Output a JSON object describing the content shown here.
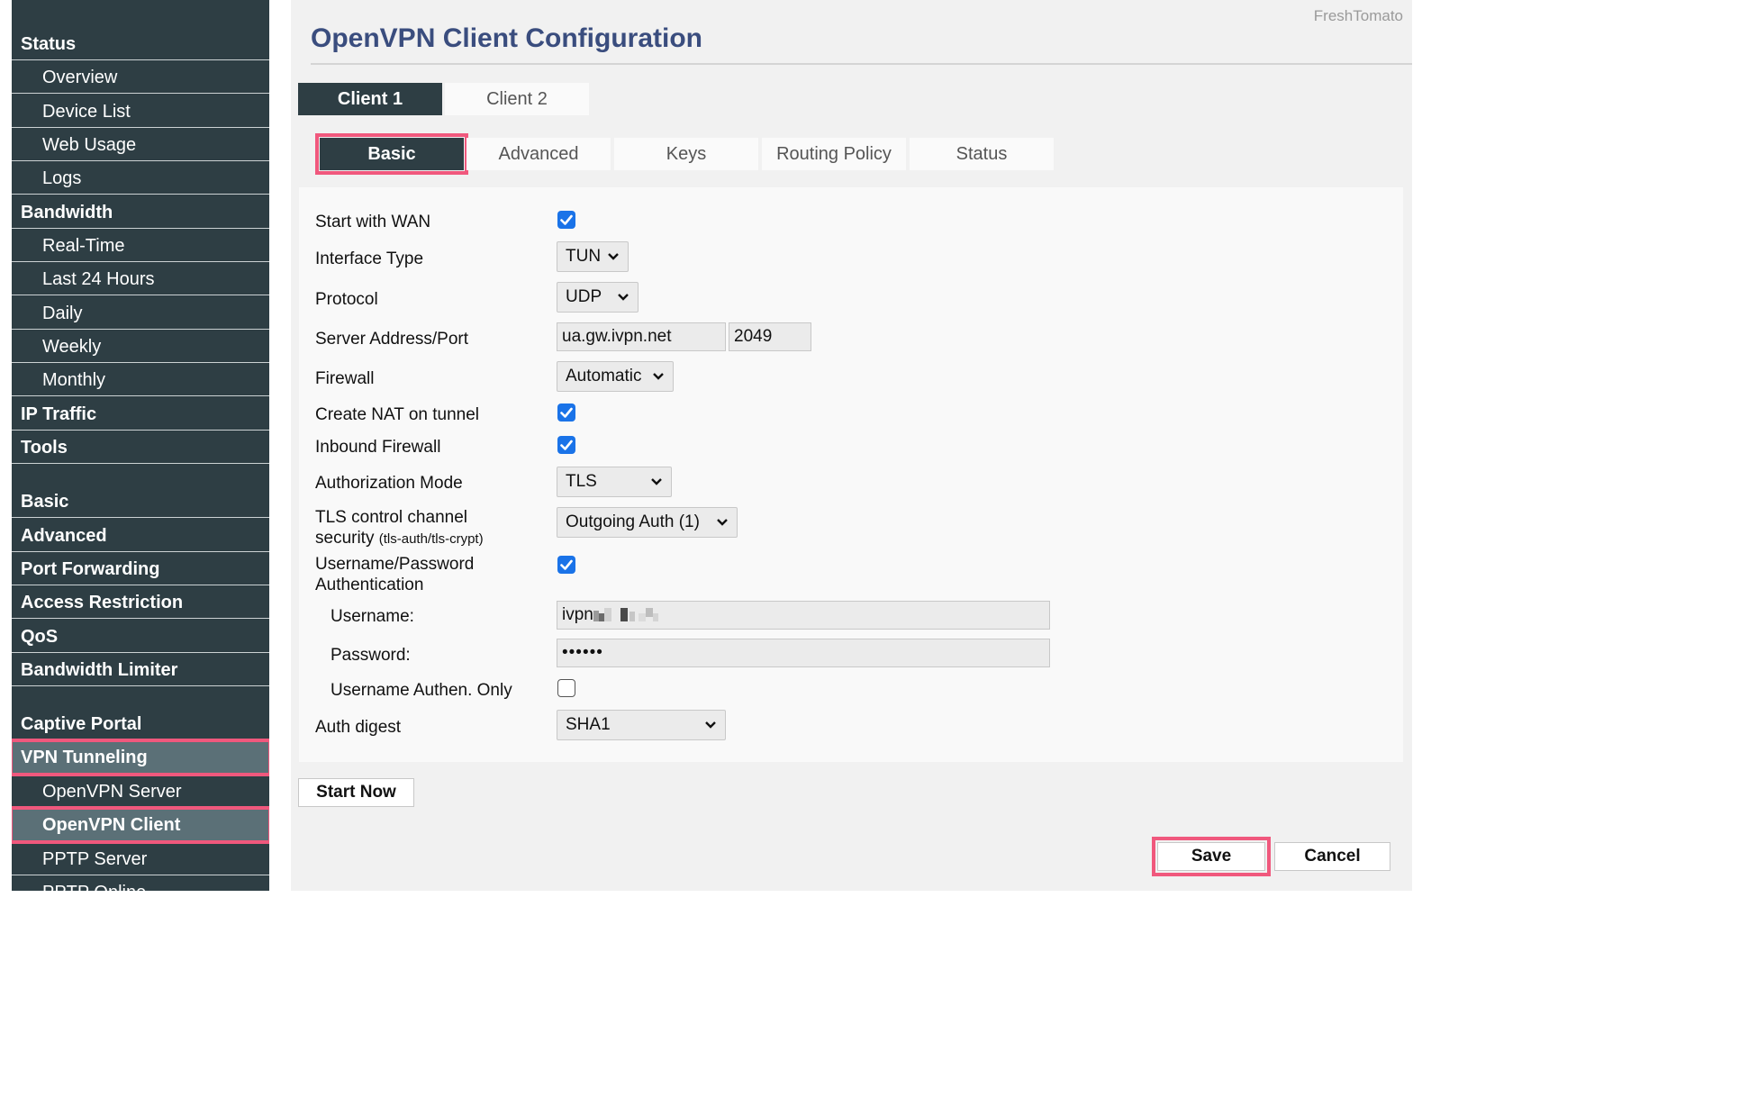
{
  "sidebar": {
    "items": [
      {
        "label": "Status",
        "kind": "section"
      },
      {
        "label": "Overview",
        "kind": "sub"
      },
      {
        "label": "Device List",
        "kind": "sub"
      },
      {
        "label": "Web Usage",
        "kind": "sub"
      },
      {
        "label": "Logs",
        "kind": "sub"
      },
      {
        "label": "Bandwidth",
        "kind": "section"
      },
      {
        "label": "Real-Time",
        "kind": "sub"
      },
      {
        "label": "Last 24 Hours",
        "kind": "sub"
      },
      {
        "label": "Daily",
        "kind": "sub"
      },
      {
        "label": "Weekly",
        "kind": "sub"
      },
      {
        "label": "Monthly",
        "kind": "sub"
      },
      {
        "label": "IP Traffic",
        "kind": "section"
      },
      {
        "label": "Tools",
        "kind": "section"
      },
      {
        "label": "Basic",
        "kind": "section"
      },
      {
        "label": "Advanced",
        "kind": "section"
      },
      {
        "label": "Port Forwarding",
        "kind": "section"
      },
      {
        "label": "Access Restriction",
        "kind": "section"
      },
      {
        "label": "QoS",
        "kind": "section"
      },
      {
        "label": "Bandwidth Limiter",
        "kind": "section"
      },
      {
        "label": "Captive Portal",
        "kind": "section"
      },
      {
        "label": "VPN Tunneling",
        "kind": "section"
      },
      {
        "label": "OpenVPN Server",
        "kind": "sub"
      },
      {
        "label": "OpenVPN Client",
        "kind": "sub"
      },
      {
        "label": "PPTP Server",
        "kind": "sub"
      },
      {
        "label": "PPTP Online",
        "kind": "sub"
      }
    ]
  },
  "header": {
    "brand": "FreshTomato",
    "title": "OpenVPN Client Configuration"
  },
  "client_tabs": [
    {
      "label": "Client 1",
      "active": true
    },
    {
      "label": "Client 2",
      "active": false
    }
  ],
  "section_tabs": [
    {
      "label": "Basic",
      "active": true
    },
    {
      "label": "Advanced",
      "active": false
    },
    {
      "label": "Keys",
      "active": false
    },
    {
      "label": "Routing Policy",
      "active": false
    },
    {
      "label": "Status",
      "active": false
    }
  ],
  "form": {
    "start_with_wan": {
      "label": "Start with WAN",
      "checked": true
    },
    "interface_type": {
      "label": "Interface Type",
      "value": "TUN"
    },
    "protocol": {
      "label": "Protocol",
      "value": "UDP"
    },
    "server": {
      "label": "Server Address/Port",
      "address": "ua.gw.ivpn.net",
      "port": "2049"
    },
    "firewall": {
      "label": "Firewall",
      "value": "Automatic"
    },
    "create_nat": {
      "label": "Create NAT on tunnel",
      "checked": true
    },
    "inbound_firewall": {
      "label": "Inbound Firewall",
      "checked": true
    },
    "auth_mode": {
      "label": "Authorization Mode",
      "value": "TLS"
    },
    "tls_control": {
      "label_line1": "TLS control channel",
      "label_line2": "security",
      "label_note": "(tls-auth/tls-crypt)",
      "value": "Outgoing Auth (1)"
    },
    "userpass_auth": {
      "label_line1": "Username/Password",
      "label_line2": "Authentication",
      "checked": true
    },
    "username": {
      "label": "Username:",
      "value": "ivpn"
    },
    "password": {
      "label": "Password:",
      "value": "••••••"
    },
    "username_only": {
      "label": "Username Authen. Only",
      "checked": false
    },
    "auth_digest": {
      "label": "Auth digest",
      "value": "SHA1"
    }
  },
  "buttons": {
    "start_now": "Start Now",
    "save": "Save",
    "cancel": "Cancel"
  },
  "colors": {
    "sidebar_bg": "#2e3e44",
    "title": "#3a4d7e",
    "highlight": "#f0587d",
    "checkbox": "#1a73e8"
  }
}
